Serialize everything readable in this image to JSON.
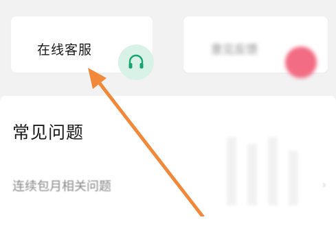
{
  "service_card": {
    "label": "在线客服",
    "icon": "headset-icon",
    "accent": "#17a46f"
  },
  "feedback_card": {
    "label": "意见反馈",
    "icon_color": "#f26c83"
  },
  "faq": {
    "title": "常见问题",
    "items": [
      {
        "label": "连续包月相关问题"
      }
    ]
  },
  "annotation": {
    "arrow_color": "#f2883a"
  }
}
